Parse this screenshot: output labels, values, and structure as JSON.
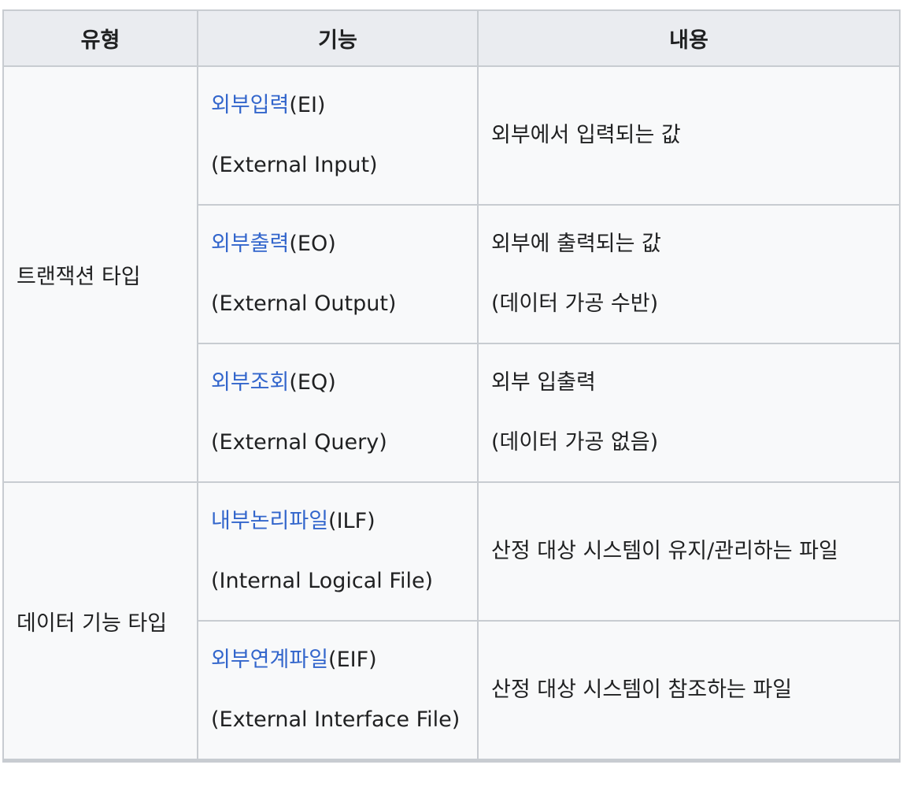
{
  "headers": [
    "유형",
    "기능",
    "내용"
  ],
  "groups": [
    {
      "type": "트랜잭션 타입"
    },
    {
      "type": "데이터 기능 타입"
    }
  ],
  "rows": [
    {
      "func_link": "외부입력",
      "func_abbr": "(EI)",
      "func_en": "(External Input)",
      "content": [
        "외부에서 입력되는 값"
      ]
    },
    {
      "func_link": "외부출력",
      "func_abbr": "(EO)",
      "func_en": "(External Output)",
      "content": [
        "외부에 출력되는 값",
        "(데이터 가공 수반)"
      ]
    },
    {
      "func_link": "외부조회",
      "func_abbr": "(EQ)",
      "func_en": "(External Query)",
      "content": [
        "외부 입출력",
        "(데이터 가공 없음)"
      ]
    },
    {
      "func_link": "내부논리파일",
      "func_abbr": "(ILF)",
      "func_en": "(Internal Logical File)",
      "content": [
        "산정 대상 시스템이 유지/관리하는 파일"
      ]
    },
    {
      "func_link": "외부연계파일",
      "func_abbr": "(EIF)",
      "func_en": "(External Interface File)",
      "content": [
        "산정 대상 시스템이 참조하는 파일"
      ]
    }
  ]
}
